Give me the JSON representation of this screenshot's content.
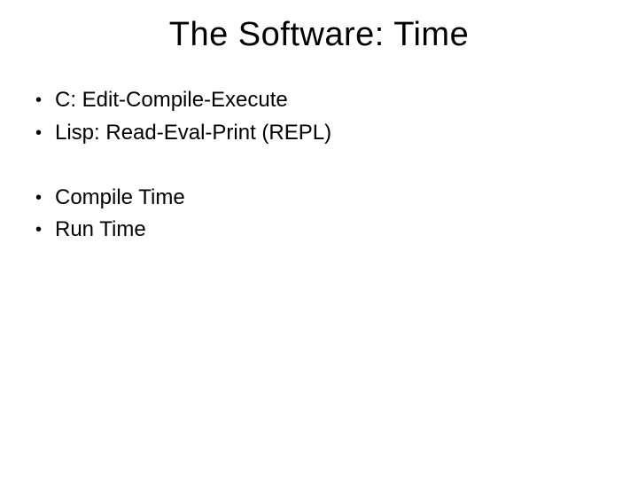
{
  "slide": {
    "title": "The Software: Time",
    "group1": [
      "C: Edit-Compile-Execute",
      "Lisp: Read-Eval-Print (REPL)"
    ],
    "group2": [
      "Compile Time",
      "Run Time"
    ]
  }
}
